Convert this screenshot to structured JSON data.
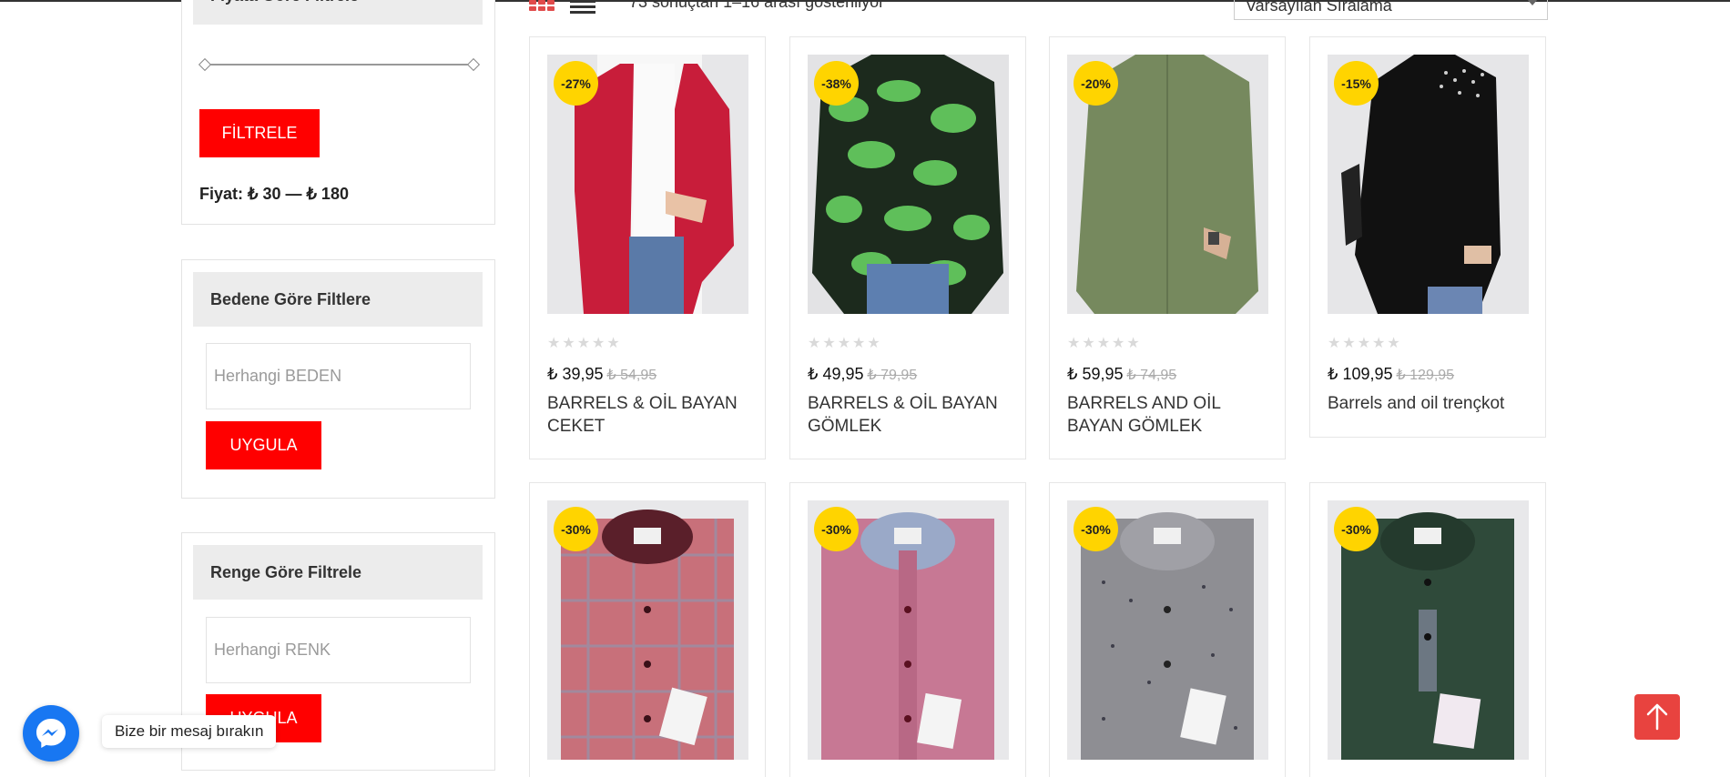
{
  "sidebar": {
    "price_filter": {
      "title": "Fiyata Göre Filtrele",
      "button_label": "FİLTRELE",
      "price_text": "Fiyat: ₺ 30 — ₺ 180"
    },
    "size_filter": {
      "title": "Bedene Göre Filtlere",
      "placeholder": "Herhangi BEDEN",
      "button_label": "UYGULA"
    },
    "color_filter": {
      "title": "Renge Göre Filtrele",
      "placeholder": "Herhangi RENK",
      "button_label": "UYGULA"
    }
  },
  "toolbar": {
    "view_grid_icon": "grid-icon",
    "view_list_icon": "list-icon",
    "result_count": "73 sonuçtan 1–16 arası gösteriliyor",
    "sort_selected": "Varsayılan Sıralama"
  },
  "products": [
    {
      "badge": "-27%",
      "price": "₺ 39,95",
      "old_price": "₺ 54,95",
      "name": "BARRELS & OİL BAYAN CEKET",
      "image": "red-cardigan"
    },
    {
      "badge": "-38%",
      "price": "₺ 49,95",
      "old_price": "₺ 79,95",
      "name": "BARRELS & OİL BAYAN GÖMLEK",
      "image": "green-leaf-shirt"
    },
    {
      "badge": "-20%",
      "price": "₺ 59,95",
      "old_price": "₺ 74,95",
      "name": "BARRELS AND OİL BAYAN GÖMLEK",
      "image": "olive-shirt"
    },
    {
      "badge": "-15%",
      "price": "₺ 109,95",
      "old_price": "₺ 129,95",
      "name": "Barrels and oil trençkot",
      "image": "black-trench"
    },
    {
      "badge": "-30%",
      "image": "red-plaid-shirt"
    },
    {
      "badge": "-30%",
      "image": "pink-shirt"
    },
    {
      "badge": "-30%",
      "image": "grey-shirt"
    },
    {
      "badge": "-30%",
      "image": "green-shirt"
    }
  ],
  "rating": "★★★★★",
  "messenger": {
    "tooltip": "Bize bir mesaj bırakın",
    "icon": "messenger-icon"
  },
  "scroll_top": {
    "icon": "arrow-up-icon"
  },
  "colors": {
    "accent": "#ff0000",
    "badge": "#ffd400",
    "scroll_top": "#e8433f",
    "messenger": "#1877f2"
  }
}
